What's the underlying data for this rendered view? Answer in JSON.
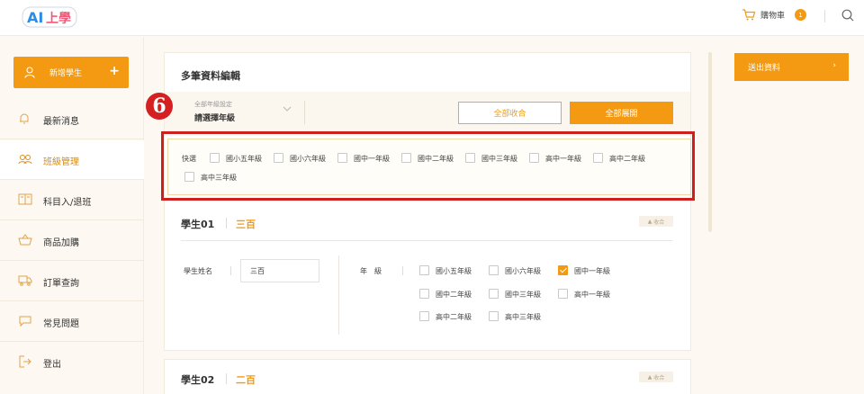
{
  "header": {
    "logo_text": "AI上學",
    "cart_label": "購物車",
    "cart_count": "1"
  },
  "sidebar": {
    "add_student_label": "新增學生",
    "add_symbol": "+",
    "items": [
      {
        "label": "最新消息",
        "icon": "bell-icon"
      },
      {
        "label": "班級管理",
        "icon": "users-icon",
        "active": true
      },
      {
        "label": "科目入/退班",
        "icon": "book-icon"
      },
      {
        "label": "商品加購",
        "icon": "basket-icon"
      },
      {
        "label": "訂單查詢",
        "icon": "truck-icon"
      },
      {
        "label": "常見問題",
        "icon": "chat-icon"
      },
      {
        "label": "登出",
        "icon": "logout-icon"
      }
    ]
  },
  "editor": {
    "title": "多筆資料編輯",
    "step_number": "6",
    "grade_select": {
      "caption": "全部年級設定",
      "value": "請選擇年級"
    },
    "collapse_all_label": "全部收合",
    "expand_all_label": "全部展開",
    "quick_label": "快選",
    "quick_options": [
      "國小五年級",
      "國小六年級",
      "國中一年級",
      "國中二年級",
      "國中三年級",
      "高中一年級",
      "高中二年級",
      "高中三年級"
    ]
  },
  "students": [
    {
      "title": "學生01",
      "name": "三百",
      "collapse_label": "收合",
      "name_field_label": "學生姓名",
      "name_value": "三百",
      "grade_field_label": "年　級",
      "grade_options": [
        {
          "label": "國小五年級",
          "checked": false
        },
        {
          "label": "國小六年級",
          "checked": false
        },
        {
          "label": "國中一年級",
          "checked": true
        },
        {
          "label": "國中二年級",
          "checked": false
        },
        {
          "label": "國中三年級",
          "checked": false
        },
        {
          "label": "高中一年級",
          "checked": false
        },
        {
          "label": "高中二年級",
          "checked": false
        },
        {
          "label": "高中三年級",
          "checked": false
        }
      ]
    },
    {
      "title": "學生02",
      "name": "二百",
      "collapse_label": "收合"
    }
  ],
  "actions": {
    "submit_label": "送出資料",
    "submit_arrow": "›"
  },
  "colors": {
    "accent": "#f39a12",
    "highlight": "#cf1f1f"
  }
}
